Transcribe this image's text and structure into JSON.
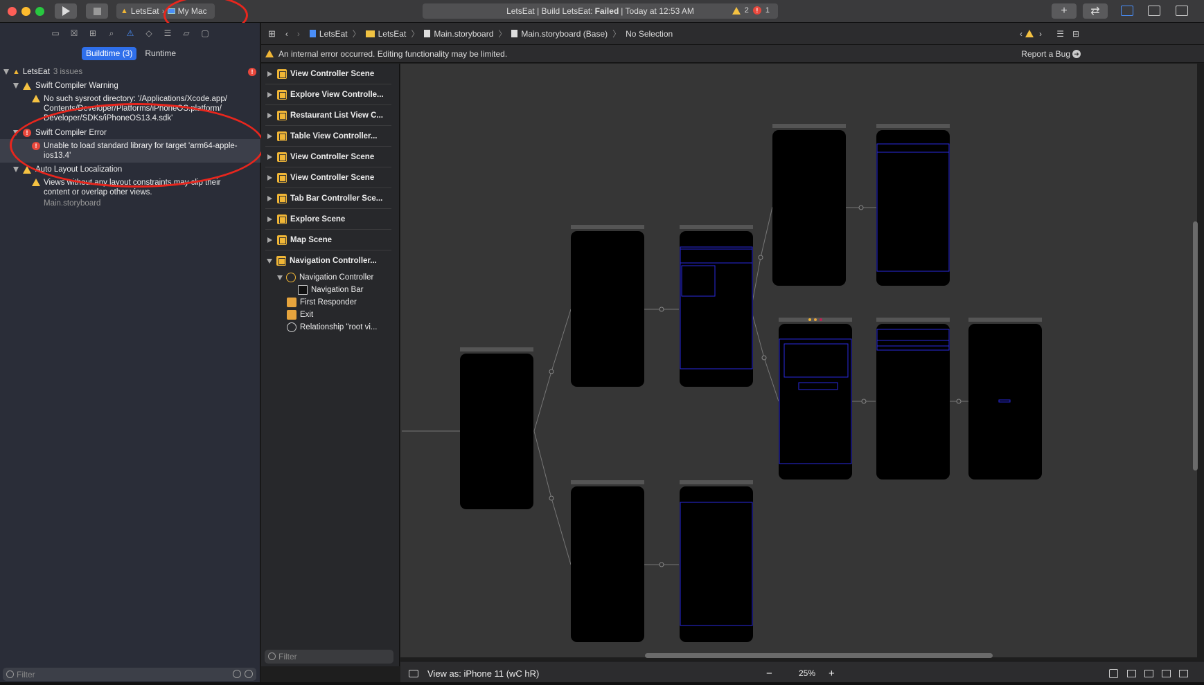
{
  "toolbar": {
    "scheme_target": "LetsEat",
    "scheme_separator": "›",
    "device": "My Mac",
    "status_prefix": "LetsEat | Build LetsEat:",
    "status_result": "Failed",
    "status_suffix": "| Today at 12:53 AM",
    "warning_count": "2",
    "error_count": "1"
  },
  "navigator": {
    "tabs": [
      "folder-icon",
      "x-square-icon",
      "hierarchy-icon",
      "search-icon",
      "warning-icon",
      "diamond-icon",
      "list-icon",
      "tag-icon",
      "comment-icon"
    ],
    "segment_buildtime": "Buildtime (3)",
    "segment_runtime": "Runtime",
    "project": "LetsEat",
    "project_issues": "3 issues",
    "groups": [
      {
        "title": "Swift Compiler Warning",
        "items": [
          {
            "line1": "No such sysroot directory: '/Applications/Xcode.app/",
            "line2": "Contents/Developer/Platforms/iPhoneOS.platform/",
            "line3": "Developer/SDKs/iPhoneOS13.4.sdk'"
          }
        ]
      },
      {
        "title": "Swift Compiler Error",
        "items": [
          {
            "line1": "Unable to load standard library for target 'arm64-apple-",
            "line2": "ios13.4'"
          }
        ]
      },
      {
        "title": "Auto Layout Localization",
        "items": [
          {
            "line1": "Views without any layout constraints may clip their",
            "line2": "content or overlap other views.",
            "sub": "Main.storyboard"
          }
        ]
      }
    ],
    "filter_placeholder": "Filter"
  },
  "jumpbar": {
    "crumbs": [
      "LetsEat",
      "LetsEat",
      "Main.storyboard",
      "Main.storyboard (Base)",
      "No Selection"
    ]
  },
  "banner": {
    "message": "An internal error occurred. Editing functionality may be limited.",
    "action": "Report a Bug"
  },
  "outline": {
    "scenes": [
      "View Controller Scene",
      "Explore View Controlle...",
      "Restaurant List View C...",
      "Table View Controller...",
      "View Controller Scene",
      "View Controller Scene",
      "Tab Bar Controller Sce...",
      "Explore Scene",
      "Map Scene",
      "Navigation Controller..."
    ],
    "children": [
      "Navigation Controller",
      "Navigation Bar",
      "First Responder",
      "Exit",
      "Relationship \"root vi..."
    ],
    "filter_placeholder": "Filter"
  },
  "bottombar": {
    "view_as": "View as: iPhone 11 (wC hR)",
    "zoom": "25%"
  },
  "colors": {
    "accent": "#2f6fea",
    "error": "#e8473c",
    "warning": "#f5c242",
    "annotation": "#e8261d"
  }
}
